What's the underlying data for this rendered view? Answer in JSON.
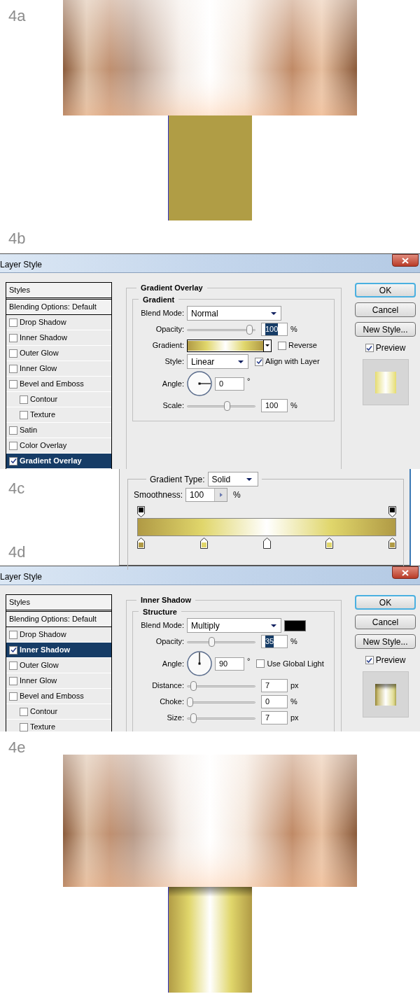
{
  "step_4a": {
    "label": "4a"
  },
  "step_4b": {
    "label": "4b",
    "dialog": {
      "kind": "gradient_overlay",
      "title": "Layer Style",
      "styles_header": "Styles",
      "blending_options": "Blending Options: Default",
      "styles": [
        {
          "name": "Drop Shadow",
          "checked": false,
          "selected": false
        },
        {
          "name": "Inner Shadow",
          "checked": false,
          "selected": false
        },
        {
          "name": "Outer Glow",
          "checked": false,
          "selected": false
        },
        {
          "name": "Inner Glow",
          "checked": false,
          "selected": false
        },
        {
          "name": "Bevel and Emboss",
          "checked": false,
          "selected": false,
          "children": [
            {
              "name": "Contour",
              "checked": false,
              "selected": false
            },
            {
              "name": "Texture",
              "checked": false,
              "selected": false
            }
          ]
        },
        {
          "name": "Satin",
          "checked": false,
          "selected": false
        },
        {
          "name": "Color Overlay",
          "checked": false,
          "selected": false
        },
        {
          "name": "Gradient Overlay",
          "checked": true,
          "selected": true
        }
      ],
      "panel_title": "Gradient Overlay",
      "group_title": "Gradient",
      "rows": [
        {
          "kind": "select",
          "label": "Blend Mode:",
          "value": "Normal",
          "wide": true,
          "swatch": false
        },
        {
          "kind": "slider",
          "label": "Opacity:",
          "level": 0.96,
          "value": "100",
          "unit": "%",
          "highlighted": true
        },
        {
          "kind": "gradient",
          "label": "Gradient:",
          "checkbox": {
            "label": "Reverse",
            "checked": false
          }
        },
        {
          "kind": "select",
          "label": "Style:",
          "value": "Linear",
          "wide": false,
          "swatch": false,
          "checkbox": {
            "label": "Align with Layer",
            "checked": true
          }
        },
        {
          "kind": "angle",
          "label": "Angle:",
          "value": "0",
          "unit": "°"
        },
        {
          "kind": "slider",
          "label": "Scale:",
          "level": 0.6,
          "value": "100",
          "unit": "%",
          "highlighted": false
        }
      ],
      "buttons": [
        "OK",
        "Cancel",
        "New Style..."
      ],
      "preview": {
        "label": "Preview",
        "checked": true
      }
    }
  },
  "step_4c": {
    "label": "4c",
    "editor": {
      "type_label": "Gradient Type:",
      "type_value": "Solid",
      "smoothness_label": "Smoothness:",
      "smoothness_value": "100",
      "unit": "%",
      "opacity_stops": [
        {
          "level": 0
        },
        {
          "level": 1
        }
      ],
      "color_stops": [
        {
          "level": 0,
          "color": "#b09a45"
        },
        {
          "level": 0.25,
          "color": "#e0d66b"
        },
        {
          "level": 0.5,
          "color": "#ffffff"
        },
        {
          "level": 0.75,
          "color": "#e0d66b"
        },
        {
          "level": 1,
          "color": "#b09a45"
        }
      ]
    }
  },
  "step_4d": {
    "label": "4d",
    "dialog": {
      "kind": "inner_shadow",
      "title": "Layer Style",
      "styles_header": "Styles",
      "blending_options": "Blending Options: Default",
      "styles": [
        {
          "name": "Drop Shadow",
          "checked": false,
          "selected": false
        },
        {
          "name": "Inner Shadow",
          "checked": true,
          "selected": true
        },
        {
          "name": "Outer Glow",
          "checked": false,
          "selected": false
        },
        {
          "name": "Inner Glow",
          "checked": false,
          "selected": false
        },
        {
          "name": "Bevel and Emboss",
          "checked": false,
          "selected": false,
          "children": [
            {
              "name": "Contour",
              "checked": false,
              "selected": false
            },
            {
              "name": "Texture",
              "checked": false,
              "selected": false
            }
          ]
        }
      ],
      "panel_title": "Inner Shadow",
      "group_title": "Structure",
      "rows": [
        {
          "kind": "select",
          "label": "Blend Mode:",
          "value": "Multiply",
          "wide": true,
          "swatch": true
        },
        {
          "kind": "slider",
          "label": "Opacity:",
          "level": 0.35,
          "value": "35",
          "unit": "%",
          "highlighted": true
        },
        {
          "kind": "angle",
          "label": "Angle:",
          "value": "90",
          "unit": "°",
          "checkbox": {
            "label": "Use Global Light",
            "checked": false
          }
        },
        {
          "kind": "slider",
          "label": "Distance:",
          "level": 0.06,
          "value": "7",
          "unit": "px",
          "highlighted": false
        },
        {
          "kind": "slider",
          "label": "Choke:",
          "level": 0,
          "value": "0",
          "unit": "%",
          "highlighted": false
        },
        {
          "kind": "slider",
          "label": "Size:",
          "level": 0.06,
          "value": "7",
          "unit": "px",
          "highlighted": false
        }
      ],
      "buttons": [
        "OK",
        "Cancel",
        "New Style..."
      ],
      "preview": {
        "label": "Preview",
        "checked": true
      }
    }
  },
  "step_4e": {
    "label": "4e"
  }
}
